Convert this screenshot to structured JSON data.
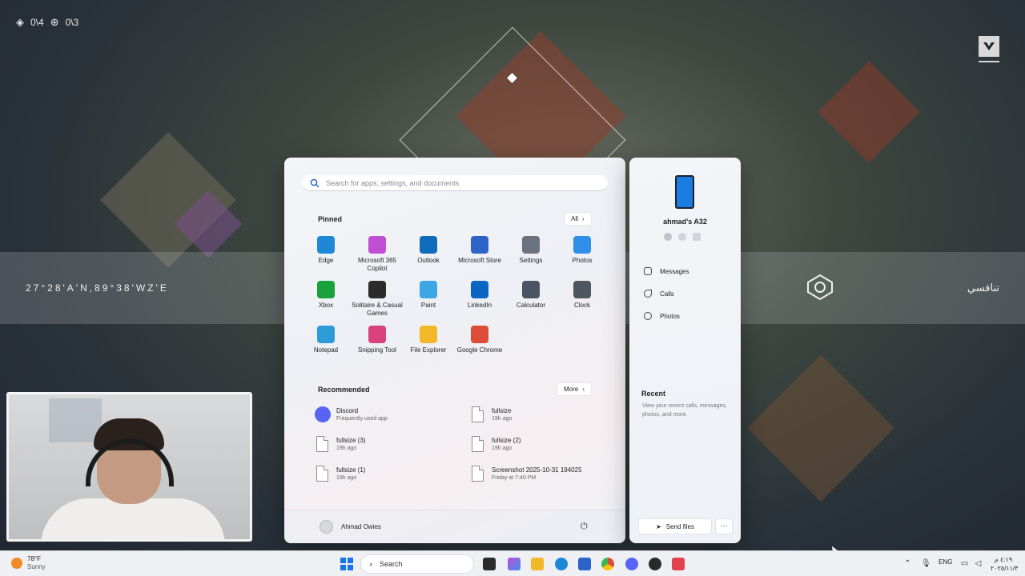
{
  "hud": {
    "score_a": "0\\4",
    "score_b": "0\\3",
    "coords": "27°28'A'N,89°38'WZ'E",
    "mode_label": "تنافسي"
  },
  "search": {
    "placeholder": "Search for apps, settings, and documents"
  },
  "pinned": {
    "title": "Pinned",
    "all_label": "All",
    "apps": [
      {
        "label": "Edge",
        "icon": "edge-icon",
        "color": "#1e88d6"
      },
      {
        "label": "Microsoft 365 Copilot",
        "icon": "copilot-icon",
        "color": "#c04fd3"
      },
      {
        "label": "Outlook",
        "icon": "outlook-icon",
        "color": "#0f6cbd"
      },
      {
        "label": "Microsoft Store",
        "icon": "store-icon",
        "color": "#2b63c8"
      },
      {
        "label": "Settings",
        "icon": "gear-icon",
        "color": "#6b7380"
      },
      {
        "label": "Photos",
        "icon": "photos-icon",
        "color": "#2f8fe8"
      },
      {
        "label": "Xbox",
        "icon": "xbox-icon",
        "color": "#18a33a"
      },
      {
        "label": "Solitaire & Casual Games",
        "icon": "solitaire-icon",
        "color": "#2b2b2b"
      },
      {
        "label": "Paint",
        "icon": "paint-icon",
        "color": "#3da7e6"
      },
      {
        "label": "LinkedIn",
        "icon": "linkedin-icon",
        "color": "#0a66c2"
      },
      {
        "label": "Calculator",
        "icon": "calculator-icon",
        "color": "#4a5563"
      },
      {
        "label": "Clock",
        "icon": "clock-icon",
        "color": "#50565f"
      },
      {
        "label": "Notepad",
        "icon": "notepad-icon",
        "color": "#2d9bd6"
      },
      {
        "label": "Snipping Tool",
        "icon": "snipping-tool-icon",
        "color": "#d9427a"
      },
      {
        "label": "File Explorer",
        "icon": "folder-icon",
        "color": "#f3b72a"
      },
      {
        "label": "Google Chrome",
        "icon": "chrome-icon",
        "color": "#dd4b39"
      }
    ]
  },
  "recommended": {
    "title": "Recommended",
    "more_label": "More",
    "items": [
      {
        "name": "Discord",
        "sub": "Frequently used app",
        "kind": "discord"
      },
      {
        "name": "fullsize",
        "sub": "19h ago",
        "kind": "file"
      },
      {
        "name": "fullsize (3)",
        "sub": "19h ago",
        "kind": "file"
      },
      {
        "name": "fullsize (2)",
        "sub": "19h ago",
        "kind": "file"
      },
      {
        "name": "fullsize (1)",
        "sub": "19h ago",
        "kind": "file"
      },
      {
        "name": "Screenshot 2025-10-31 194025",
        "sub": "Friday at 7:40 PM",
        "kind": "file"
      }
    ]
  },
  "user": {
    "name": "Ahmad Owies"
  },
  "phone": {
    "device_name": "ahmad's A32",
    "menu": [
      "Messages",
      "Calls",
      "Photos"
    ],
    "recent_title": "Recent",
    "recent_sub": "View your recent calls, messages, photos, and more.",
    "send_label": "Send files",
    "more_label": "···"
  },
  "taskbar": {
    "temp": "78°F",
    "condition": "Sunny",
    "search_label": "Search",
    "lang": "ENG",
    "time": "٤:١٩ م",
    "date": "٢٠٢٥/١١/٣"
  },
  "colors": {
    "accent": "#1a73e8",
    "start_bg": "#f1f3f7",
    "taskbar_bg": "#eef0f4"
  }
}
